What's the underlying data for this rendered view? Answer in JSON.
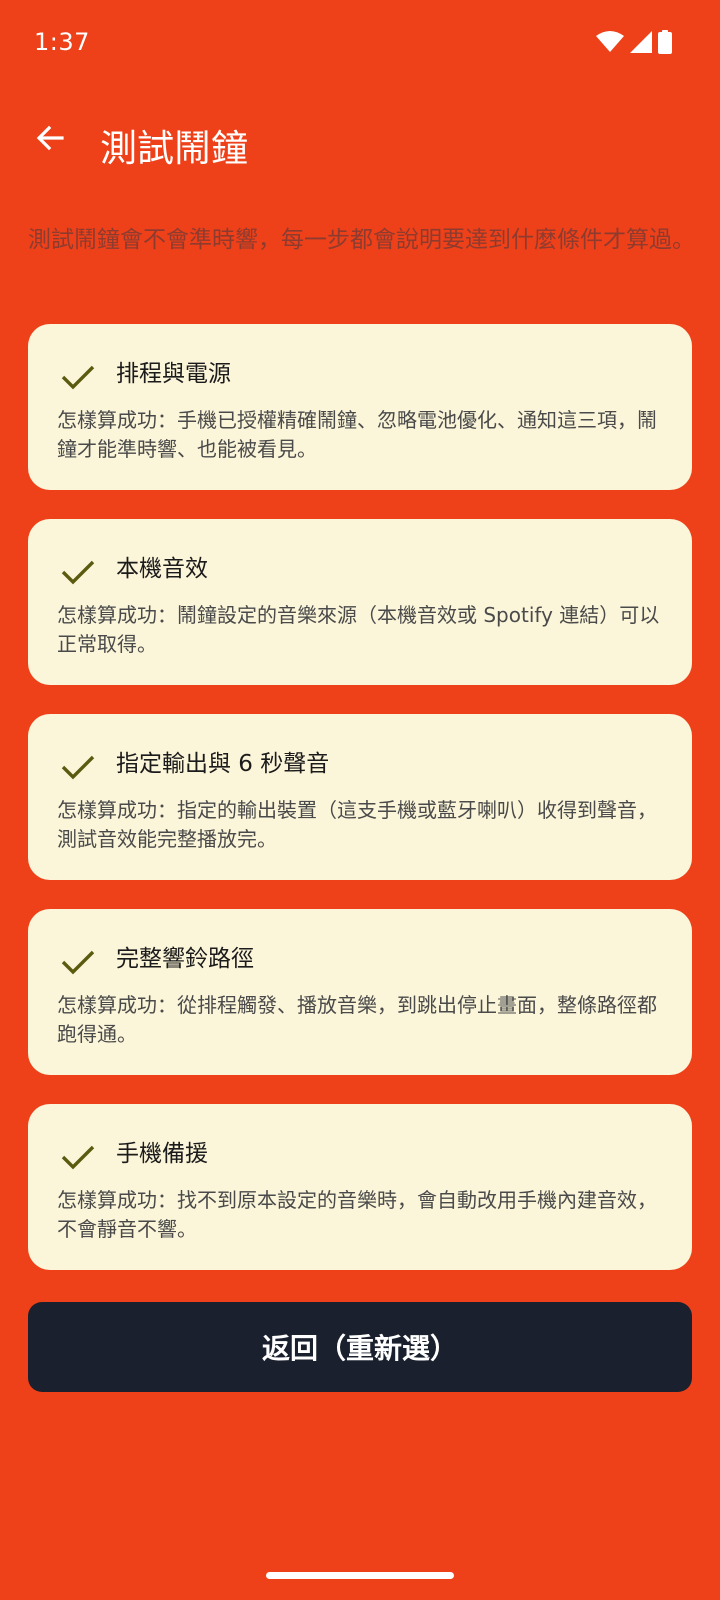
{
  "status_bar": {
    "time": "1:37",
    "icons": [
      "wifi-icon",
      "signal-icon",
      "battery-icon"
    ]
  },
  "app_bar": {
    "back_icon": "arrow-back-icon",
    "title": "測試鬧鐘"
  },
  "intro_text": "測試鬧鐘會不會準時響，每一步都會說明要達到什麼條件才算過。",
  "checks": [
    {
      "status_icon": "check-icon",
      "title": "排程與電源",
      "description": "怎樣算成功：手機已授權精確鬧鐘、忽略電池優化、通知這三項，鬧鐘才能準時響、也能被看見。"
    },
    {
      "status_icon": "check-icon",
      "title": "本機音效",
      "description": "怎樣算成功：鬧鐘設定的音樂來源（本機音效或 Spotify 連結）可以正常取得。"
    },
    {
      "status_icon": "check-icon",
      "title": "指定輸出與 6 秒聲音",
      "description": "怎樣算成功：指定的輸出裝置（這支手機或藍牙喇叭）收得到聲音，測試音效能完整播放完。"
    },
    {
      "status_icon": "check-icon",
      "title": "完整響鈴路徑",
      "description": "怎樣算成功：從排程觸發、播放音樂，到跳出停止畫面，整條路徑都跑得通。"
    },
    {
      "status_icon": "check-icon",
      "title": "手機備援",
      "description": "怎樣算成功：找不到原本設定的音樂時，會自動改用手機內建音效，不會靜音不響。"
    }
  ],
  "back_button_label": "返回（重新選）",
  "colors": {
    "background": "#EE4119",
    "card": "#FBF5D9",
    "check": "#5B5B10",
    "button": "#1A202D"
  }
}
